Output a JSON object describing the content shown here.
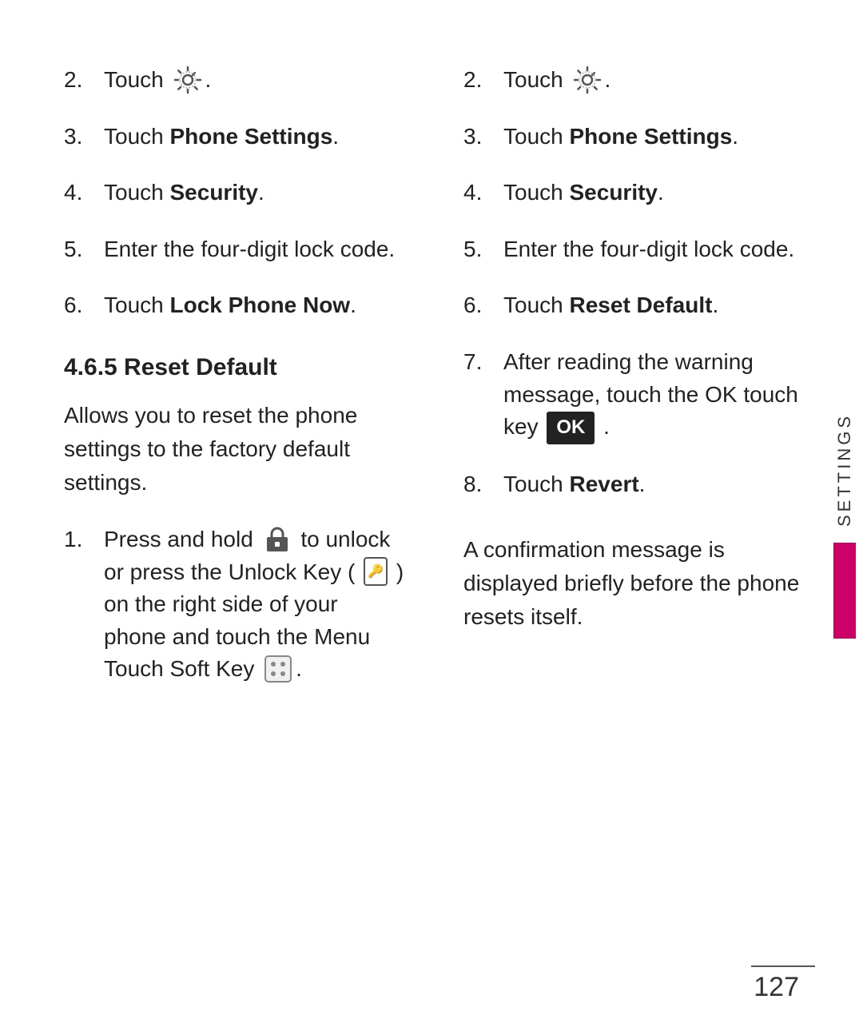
{
  "left": {
    "steps": [
      {
        "number": "2.",
        "text": "Touch",
        "hasGearIcon": true,
        "textAfter": "."
      },
      {
        "number": "3.",
        "text": "Touch ",
        "boldText": "Phone Settings",
        "textAfter": "."
      },
      {
        "number": "4.",
        "text": "Touch ",
        "boldText": "Security",
        "textAfter": "."
      },
      {
        "number": "5.",
        "text": "Enter the four-digit lock code."
      },
      {
        "number": "6.",
        "text": "Touch ",
        "boldText": "Lock Phone Now",
        "textAfter": "."
      }
    ],
    "sectionTitle": "4.6.5 Reset Default",
    "sectionDesc": "Allows you to reset the phone settings to the factory default settings.",
    "step1": {
      "number": "1.",
      "text": "Press and hold",
      "textMid": "to unlock or press the Unlock Key (",
      "textEnd": ") on the right side of your phone and touch the Menu Touch Soft Key",
      "textFinal": "."
    }
  },
  "right": {
    "steps": [
      {
        "number": "2.",
        "text": "Touch",
        "hasGearIcon": true,
        "textAfter": "."
      },
      {
        "number": "3.",
        "text": "Touch ",
        "boldText": "Phone Settings",
        "textAfter": "."
      },
      {
        "number": "4.",
        "text": "Touch ",
        "boldText": "Security",
        "textAfter": "."
      },
      {
        "number": "5.",
        "text": "Enter the four-digit lock code."
      },
      {
        "number": "6.",
        "text": "Touch ",
        "boldText": "Reset Default",
        "textAfter": "."
      },
      {
        "number": "7.",
        "text": "After reading the warning message, touch the OK touch key",
        "hasOkBadge": true,
        "textAfter": "."
      },
      {
        "number": "8.",
        "text": "Touch ",
        "boldText": "Revert",
        "textAfter": "."
      }
    ],
    "confirmationNote": "A confirmation message is displayed briefly before the phone resets itself."
  },
  "sidebar": {
    "label": "SETTINGS"
  },
  "pageNumber": "127"
}
